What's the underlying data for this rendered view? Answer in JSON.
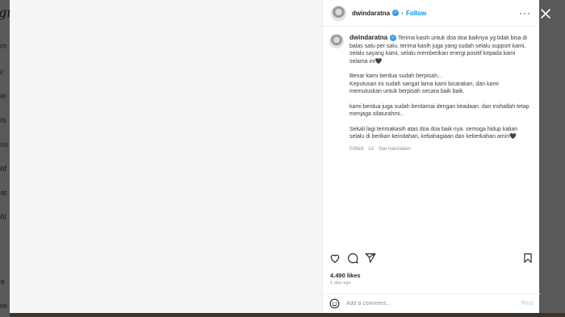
{
  "background": {
    "logo_fragment": "gr",
    "sidebar_fragments": [
      "om",
      "ar",
      "plo",
      "els",
      "ess",
      "otif",
      "eat",
      "ofil",
      "ire",
      "ore"
    ]
  },
  "post": {
    "username": "dwindaratna",
    "follow_label": "Follow",
    "caption": {
      "username": "dwindaratna",
      "paragraph_1": "Terima kasih untuk doa doa baiknya yg tidak bisa di balas satu per satu. terima kasih juga yang sudah selalu support kami, selalu sayang kami, selalu memberikan energi positif kepada kami selama ini🖤",
      "paragraph_2": "Benar kami berdua sudah berpisah...\nKeputusan ini sudah sangat lama kami bicarakan, dan kami memutuskan untuk berpisah secara baik baik.",
      "paragraph_3": "kami berdua juga sudah berdamai dengan keadaan. dan inshallah tetap menjaga silaturahmi..",
      "paragraph_4": "Sekali lagi terimakasih atas doa doa baik nya. semoga hidup kalian selalu di berikan keindahan, kebahagiaan dan keberkahan amin🖤",
      "edited": "Edited",
      "time": "1d",
      "see_translation": "See translation"
    },
    "likes": "4.490 likes",
    "posted_ago": "1 day ago",
    "comment_placeholder": "Add a comment...",
    "post_label": "Post"
  },
  "icons": {
    "close": "close-icon",
    "more": "more-options-icon",
    "like": "heart-icon",
    "comment": "comment-icon",
    "share": "share-icon",
    "save": "bookmark-icon",
    "emoji": "emoji-icon"
  },
  "colors": {
    "overlay": "#595959",
    "link": "#0095f6",
    "verified": "#3897f0",
    "post_disabled": "#b2dffc"
  }
}
